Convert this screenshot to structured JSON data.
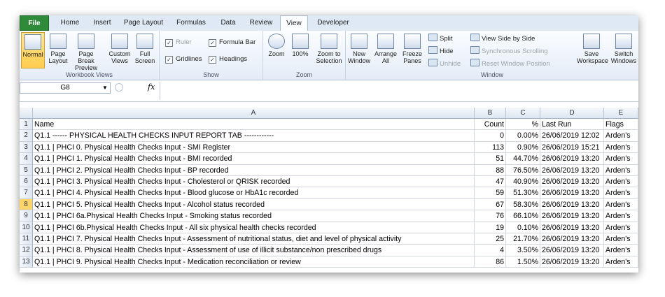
{
  "tabs": [
    "File",
    "Home",
    "Insert",
    "Page Layout",
    "Formulas",
    "Data",
    "Review",
    "View",
    "Developer"
  ],
  "ribbon": {
    "workbook_views": {
      "label": "Workbook Views",
      "buttons": [
        "Normal",
        "Page Layout",
        "Page Break Preview",
        "Custom Views",
        "Full Screen"
      ]
    },
    "show": {
      "label": "Show",
      "ruler": "Ruler",
      "formula_bar": "Formula Bar",
      "gridlines": "Gridlines",
      "headings": "Headings"
    },
    "zoom": {
      "label": "Zoom",
      "buttons": [
        "Zoom",
        "100%",
        "Zoom to Selection"
      ]
    },
    "window": {
      "label": "Window",
      "new_window": "New Window",
      "arrange_all": "Arrange All",
      "freeze_panes": "Freeze Panes",
      "split": "Split",
      "hide": "Hide",
      "unhide": "Unhide",
      "view_side_by_side": "View Side by Side",
      "sync_scrolling": "Synchronous Scrolling",
      "reset_window_position": "Reset Window Position",
      "save_workspace": "Save Workspace",
      "switch_windows": "Switch Windows"
    }
  },
  "formula_bar": {
    "name_box": "G8",
    "fx": "fx",
    "content": ""
  },
  "columns": [
    "A",
    "B",
    "C",
    "D",
    "E"
  ],
  "rows": [
    {
      "n": "1",
      "a": "Name",
      "b": "Count",
      "c": "%",
      "d": "Last Run",
      "e": "Flags"
    },
    {
      "n": "2",
      "a": "Q1.1  ------ PHYSICAL HEALTH CHECKS INPUT REPORT TAB ------------",
      "b": "0",
      "c": "0.00%",
      "d": "26/06/2019 12:02",
      "e": "Arden's"
    },
    {
      "n": "3",
      "a": "Q1.1 | PHCI 0.  Physical Health Checks Input - SMI Register",
      "b": "113",
      "c": "0.90%",
      "d": "26/06/2019 15:21",
      "e": "Arden's"
    },
    {
      "n": "4",
      "a": "Q1.1 | PHCI 1.  Physical Health Checks Input - BMI recorded",
      "b": "51",
      "c": "44.70%",
      "d": "26/06/2019 13:20",
      "e": "Arden's"
    },
    {
      "n": "5",
      "a": "Q1.1 | PHCI 2.  Physical Health Checks Input - BP recorded",
      "b": "88",
      "c": "76.50%",
      "d": "26/06/2019 13:20",
      "e": "Arden's"
    },
    {
      "n": "6",
      "a": "Q1.1 | PHCI 3.  Physical Health Checks Input - Cholesterol or QRISK recorded",
      "b": "47",
      "c": "40.90%",
      "d": "26/06/2019 13:20",
      "e": "Arden's"
    },
    {
      "n": "7",
      "a": "Q1.1 | PHCI 4.  Physical Health Checks Input - Blood glucose or HbA1c recorded",
      "b": "59",
      "c": "51.30%",
      "d": "26/06/2019 13:20",
      "e": "Arden's"
    },
    {
      "n": "8",
      "a": "Q1.1 | PHCI 5.  Physical Health Checks Input - Alcohol status recorded",
      "b": "67",
      "c": "58.30%",
      "d": "26/06/2019 13:20",
      "e": "Arden's"
    },
    {
      "n": "9",
      "a": "Q1.1 | PHCI 6a.Physical Health Checks Input - Smoking status recorded",
      "b": "76",
      "c": "66.10%",
      "d": "26/06/2019 13:20",
      "e": "Arden's"
    },
    {
      "n": "10",
      "a": "Q1.1 | PHCI 6b.Physical Health Checks Input - All six physical health checks recorded",
      "b": "19",
      "c": "0.10%",
      "d": "26/06/2019 13:20",
      "e": "Arden's"
    },
    {
      "n": "11",
      "a": "Q1.1 | PHCI 7.  Physical Health Checks Input -  Assessment of nutritional status, diet and level of physical activity",
      "b": "25",
      "c": "21.70%",
      "d": "26/06/2019 13:20",
      "e": "Arden's"
    },
    {
      "n": "12",
      "a": "Q1.1 | PHCI 8.  Physical Health Checks Input - Assessment of use of illicit substance/non prescribed drugs",
      "b": "4",
      "c": "3.50%",
      "d": "26/06/2019 13:20",
      "e": "Arden's"
    },
    {
      "n": "13",
      "a": "Q1.1 | PHCI 9.  Physical Health Checks Input - Medication reconciliation or review",
      "b": "86",
      "c": "1.50%",
      "d": "26/06/2019 13:20",
      "e": "Arden's"
    }
  ],
  "selected_row": "8",
  "colors": {
    "file_tab": "#2f8a3a",
    "selected": "#fbd56a",
    "ribbon": "#e3ecf7"
  }
}
